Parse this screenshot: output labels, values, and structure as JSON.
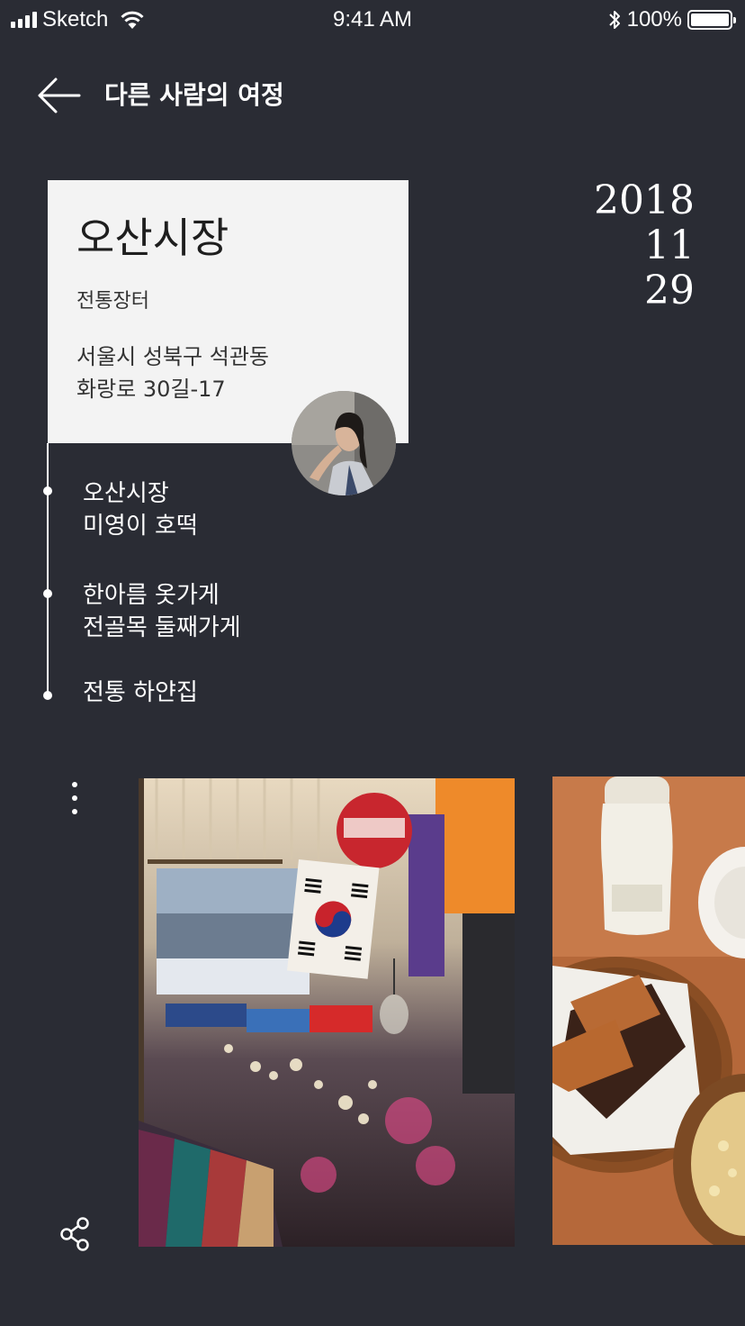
{
  "status_bar": {
    "carrier": "Sketch",
    "time": "9:41 AM",
    "battery": "100%"
  },
  "header": {
    "title": "다른 사람의 여정"
  },
  "date": {
    "year": "2018",
    "month": "11",
    "day": "29"
  },
  "place": {
    "name": "오산시장",
    "category": "전통장터",
    "address_line1": "서울시 성북구 석관동",
    "address_line2": "화랑로 30길-17"
  },
  "timeline": [
    {
      "line1": "오산시장",
      "line2": "미영이 호떡"
    },
    {
      "line1": "한아름 옷가게",
      "line2": "전골목 둘째가게"
    },
    {
      "line1": "전통 하얀집",
      "line2": ""
    }
  ],
  "icons": {
    "back": "arrow-left-icon",
    "more": "more-vertical-icon",
    "share": "share-icon"
  },
  "colors": {
    "background": "#2a2c34",
    "card": "#f3f3f3",
    "text_light": "#ffffff",
    "text_dark": "#222222"
  }
}
